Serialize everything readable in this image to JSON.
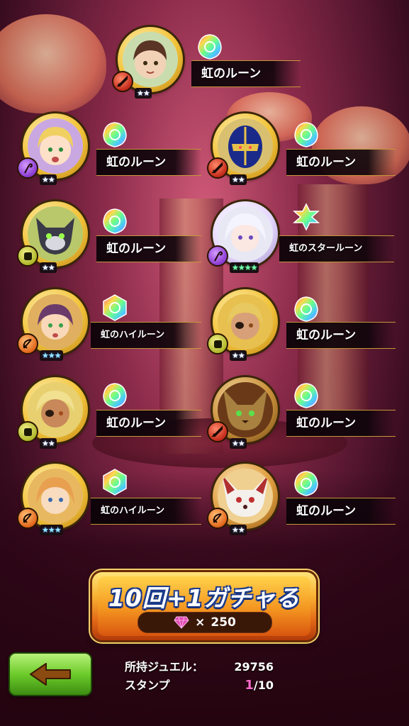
{
  "items": [
    {
      "id": "p1",
      "name": "虹のルーン",
      "stars": "★★",
      "star_style": "white",
      "class": "sword",
      "badge": "red",
      "rune": "rainbow"
    },
    {
      "id": "p2",
      "name": "虹のルーン",
      "stars": "★★",
      "star_style": "white",
      "class": "staff",
      "badge": "purple",
      "rune": "rainbow"
    },
    {
      "id": "p3",
      "name": "虹のルーン",
      "stars": "★★",
      "star_style": "white",
      "class": "sword",
      "badge": "red",
      "rune": "rainbow"
    },
    {
      "id": "p4",
      "name": "虹のルーン",
      "stars": "★★",
      "star_style": "white",
      "class": "fist",
      "badge": "green",
      "rune": "rainbow"
    },
    {
      "id": "p5",
      "name": "虹のスタールーン",
      "stars": "★★★★",
      "star_style": "green",
      "class": "staff",
      "badge": "purple",
      "rune": "star"
    },
    {
      "id": "p6",
      "name": "虹のハイルーン",
      "stars": "★★★",
      "star_style": "cyan",
      "class": "bow",
      "badge": "orange",
      "rune": "high"
    },
    {
      "id": "p7",
      "name": "虹のルーン",
      "stars": "★★",
      "star_style": "white",
      "class": "fist",
      "badge": "green",
      "rune": "rainbow"
    },
    {
      "id": "p8",
      "name": "虹のルーン",
      "stars": "★★",
      "star_style": "white",
      "class": "fist",
      "badge": "green",
      "rune": "rainbow"
    },
    {
      "id": "p9",
      "name": "虹のルーン",
      "stars": "★★",
      "star_style": "white",
      "class": "sword",
      "badge": "red",
      "rune": "rainbow"
    },
    {
      "id": "p10",
      "name": "虹のハイルーン",
      "stars": "★★★",
      "star_style": "cyan",
      "class": "bow",
      "badge": "orange",
      "rune": "high"
    },
    {
      "id": "p11",
      "name": "虹のルーン",
      "stars": "★★",
      "star_style": "white",
      "class": "bow",
      "badge": "orange",
      "rune": "rainbow"
    }
  ],
  "gacha": {
    "title": "10回+1ガチャる",
    "cost_prefix": "×",
    "cost": "250",
    "gem_icon": "jewel-icon",
    "gem_color": "#e04ab4"
  },
  "back_button": {
    "icon": "arrow-left-icon",
    "color": "#6ccb2a"
  },
  "info": {
    "jewel_label": "所持ジュエル：",
    "jewel_value": "29756",
    "stamp_label": "スタンプ",
    "stamp_current": "1",
    "stamp_total": "/10"
  }
}
